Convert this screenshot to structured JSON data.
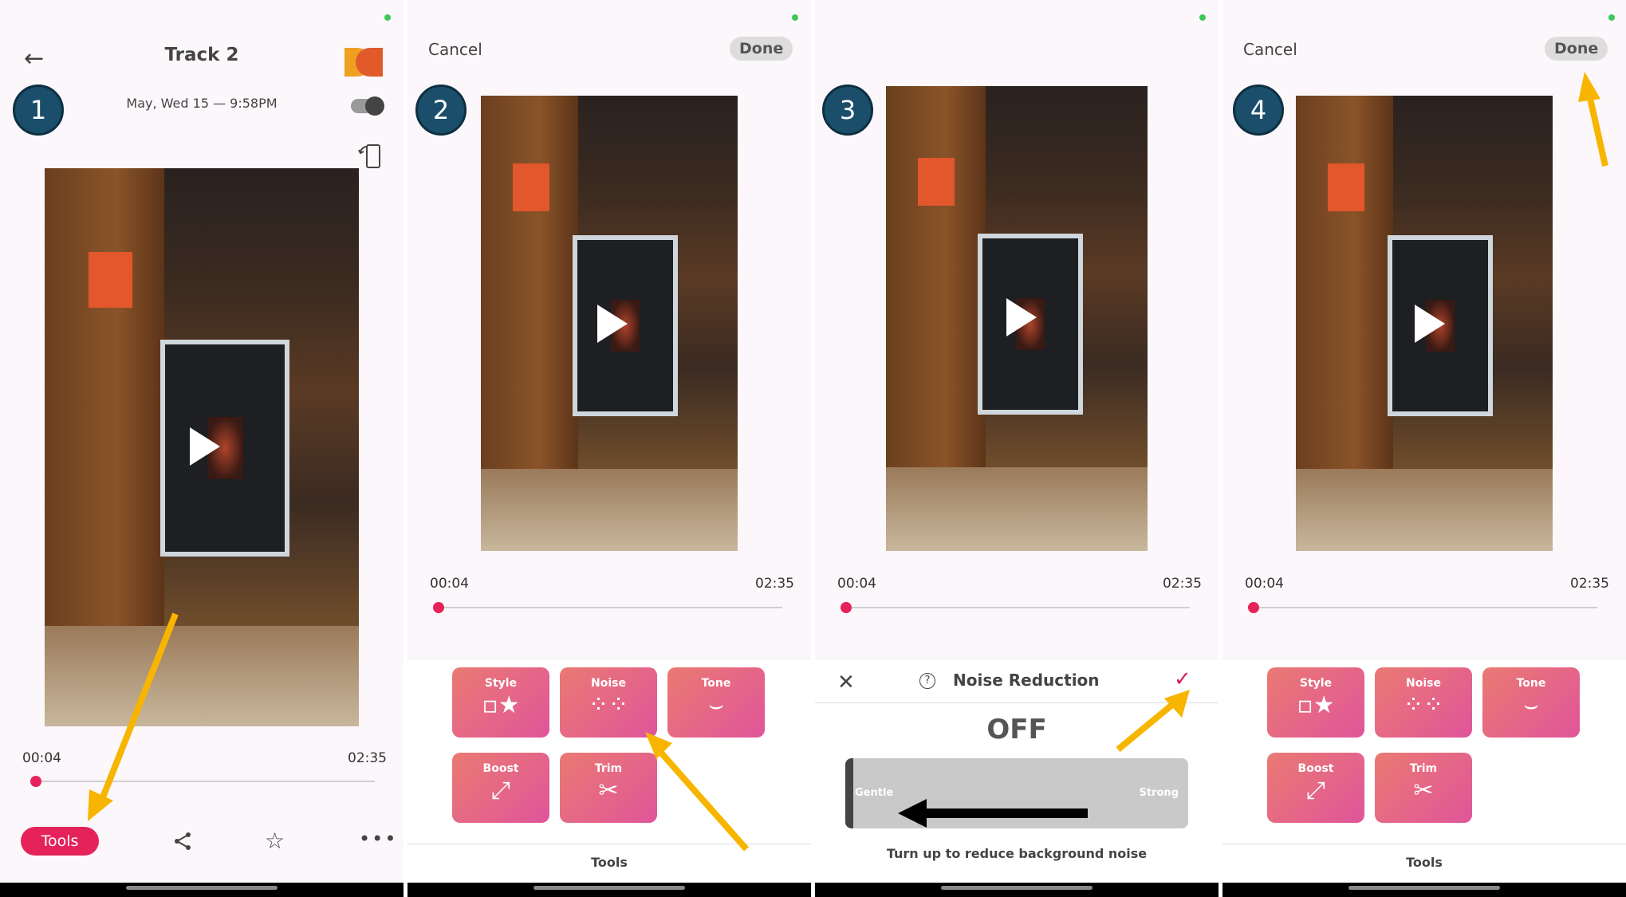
{
  "panel1": {
    "step": "1",
    "title": "Track 2",
    "date": "May, Wed 15 — 9:58PM",
    "time_current": "00:04",
    "time_total": "02:35",
    "tools_label": "Tools"
  },
  "panel2": {
    "step": "2",
    "cancel": "Cancel",
    "done": "Done",
    "time_current": "00:04",
    "time_total": "02:35",
    "tiles": [
      {
        "label": "Style",
        "icon": "◻★◻◻"
      },
      {
        "label": "Noise",
        "icon": "⁘⁘"
      },
      {
        "label": "Tone",
        "icon": "Ü"
      },
      {
        "label": "Boost",
        "icon": "⤢"
      },
      {
        "label": "Trim",
        "icon": "✂"
      }
    ],
    "footer": "Tools"
  },
  "panel3": {
    "step": "3",
    "time_current": "00:04",
    "time_total": "02:35",
    "title": "Noise Reduction",
    "state": "OFF",
    "gentle": "Gentle",
    "strong": "Strong",
    "hint": "Turn up to reduce background noise"
  },
  "panel4": {
    "step": "4",
    "cancel": "Cancel",
    "done": "Done",
    "time_current": "00:04",
    "time_total": "02:35",
    "footer": "Tools"
  },
  "colors": {
    "accent": "#e5235a",
    "step_circle": "#1a4e6b",
    "arrow": "#f7b500",
    "tile_start": "#ea7a72",
    "tile_end": "#e0559a"
  }
}
